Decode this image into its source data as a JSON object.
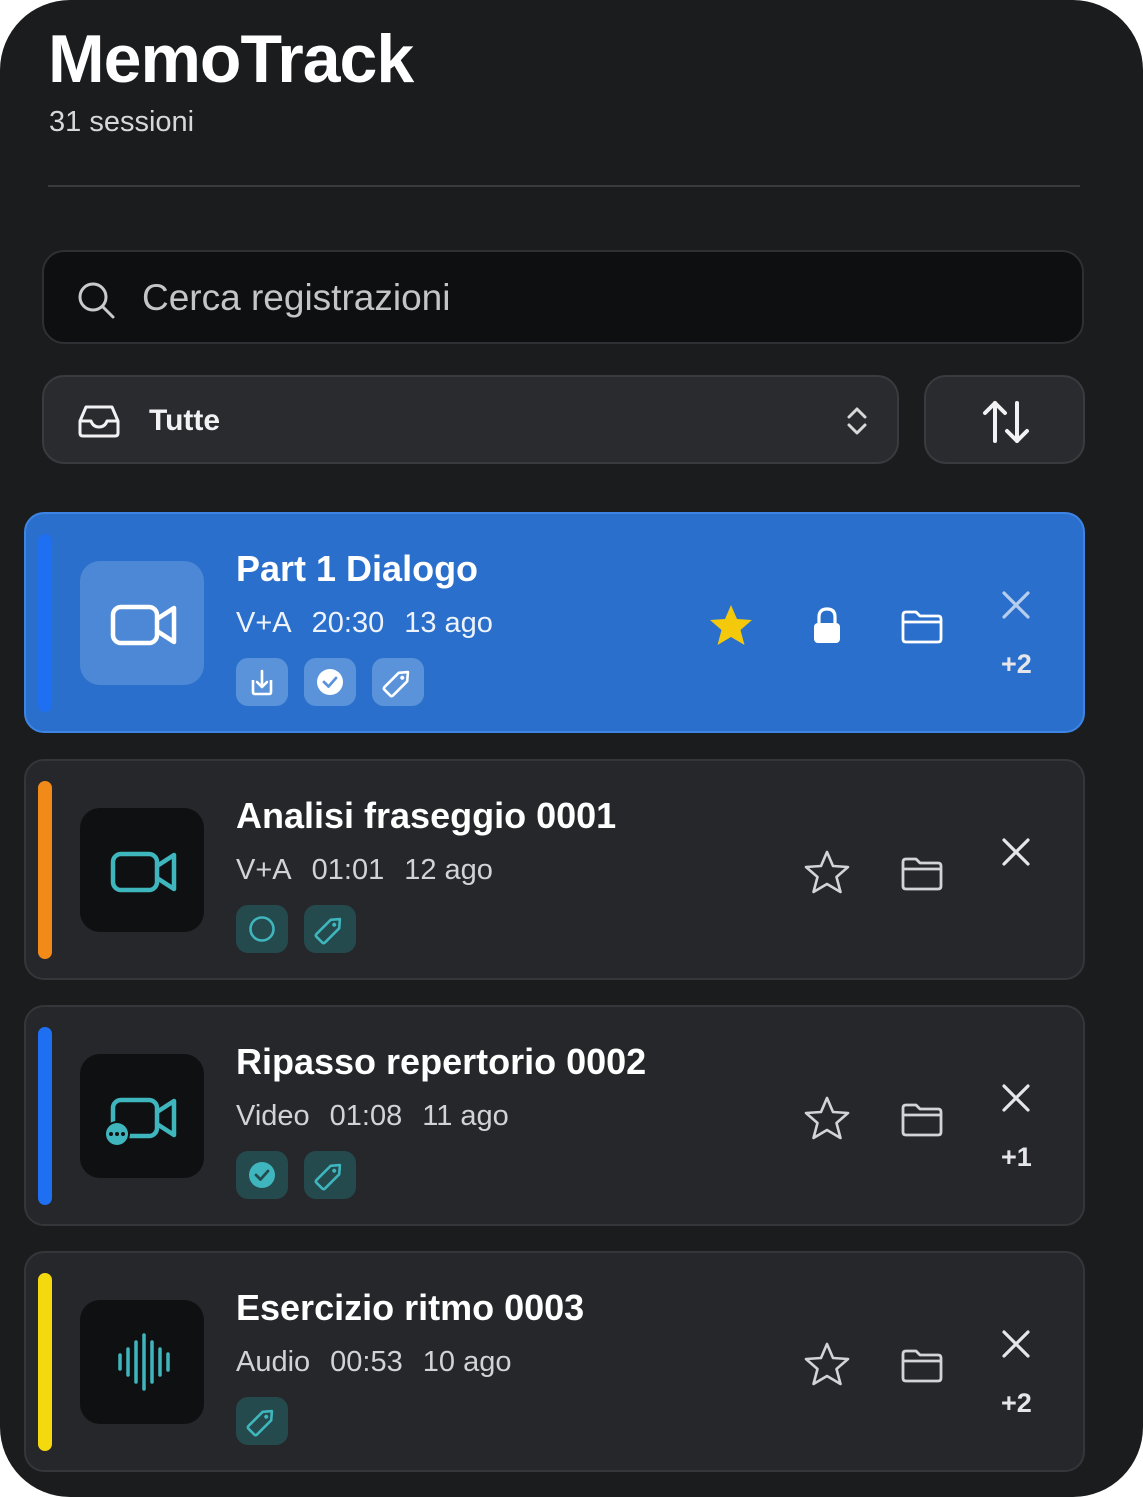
{
  "app": {
    "title": "MemoTrack",
    "subtitle": "31 sessioni"
  },
  "search": {
    "placeholder": "Cerca registrazioni",
    "value": ""
  },
  "filter": {
    "selected": "Tutte"
  },
  "colors": {
    "accent": "#2a6fcb",
    "teal": "#3fb6bd",
    "star": "#f4c90c"
  },
  "recordings": [
    {
      "title": "Part 1 Dialogo",
      "type": "V+A",
      "duration": "20:30",
      "date": "13 ago",
      "extra": "+2",
      "selected": true,
      "starred": true,
      "locked": true,
      "bar_color": "#1f6ff2",
      "icon": "video-camera-icon",
      "tags": [
        "download-tray-icon",
        "check-badge-icon",
        "tag-icon"
      ]
    },
    {
      "title": "Analisi fraseggio 0001",
      "type": "V+A",
      "duration": "01:01",
      "date": "12 ago",
      "extra": "",
      "selected": false,
      "starred": false,
      "locked": false,
      "bar_color": "#f28a1a",
      "icon": "video-camera-icon",
      "tags": [
        "circle-icon",
        "tag-icon"
      ]
    },
    {
      "title": "Ripasso repertorio 0002",
      "type": "Video",
      "duration": "01:08",
      "date": "11 ago",
      "extra": "+1",
      "selected": false,
      "starred": false,
      "locked": false,
      "bar_color": "#1f6ff2",
      "icon": "video-camera-pending-icon",
      "tags": [
        "check-badge-icon",
        "tag-icon"
      ]
    },
    {
      "title": "Esercizio ritmo 0003",
      "type": "Audio",
      "duration": "00:53",
      "date": "10 ago",
      "extra": "+2",
      "selected": false,
      "starred": false,
      "locked": false,
      "bar_color": "#f5d90f",
      "icon": "audio-waveform-icon",
      "tags": [
        "tag-icon"
      ]
    }
  ]
}
